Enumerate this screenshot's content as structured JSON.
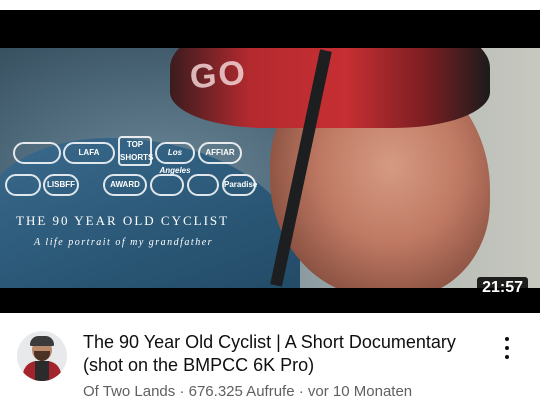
{
  "video": {
    "duration": "21:57",
    "thumbnail": {
      "overlay_title": "THE 90 YEAR OLD CYCLIST",
      "overlay_subtitle": "A life portrait of my grandfather",
      "helmet_text": "GO",
      "laurels": [
        "LAFA",
        "TOP SHORTS",
        "Los Angeles",
        "AFFIAR",
        "LISBFF",
        "AWARD",
        "Paradise"
      ]
    },
    "title": "The 90 Year Old Cyclist | A Short Documentary (shot on the BMPCC 6K Pro)",
    "channel": "Of Two Lands",
    "separator": " · ",
    "views": "676.325 Aufrufe",
    "age": "vor 10 Monaten"
  },
  "icons": {
    "menu": "more-vert-icon"
  }
}
